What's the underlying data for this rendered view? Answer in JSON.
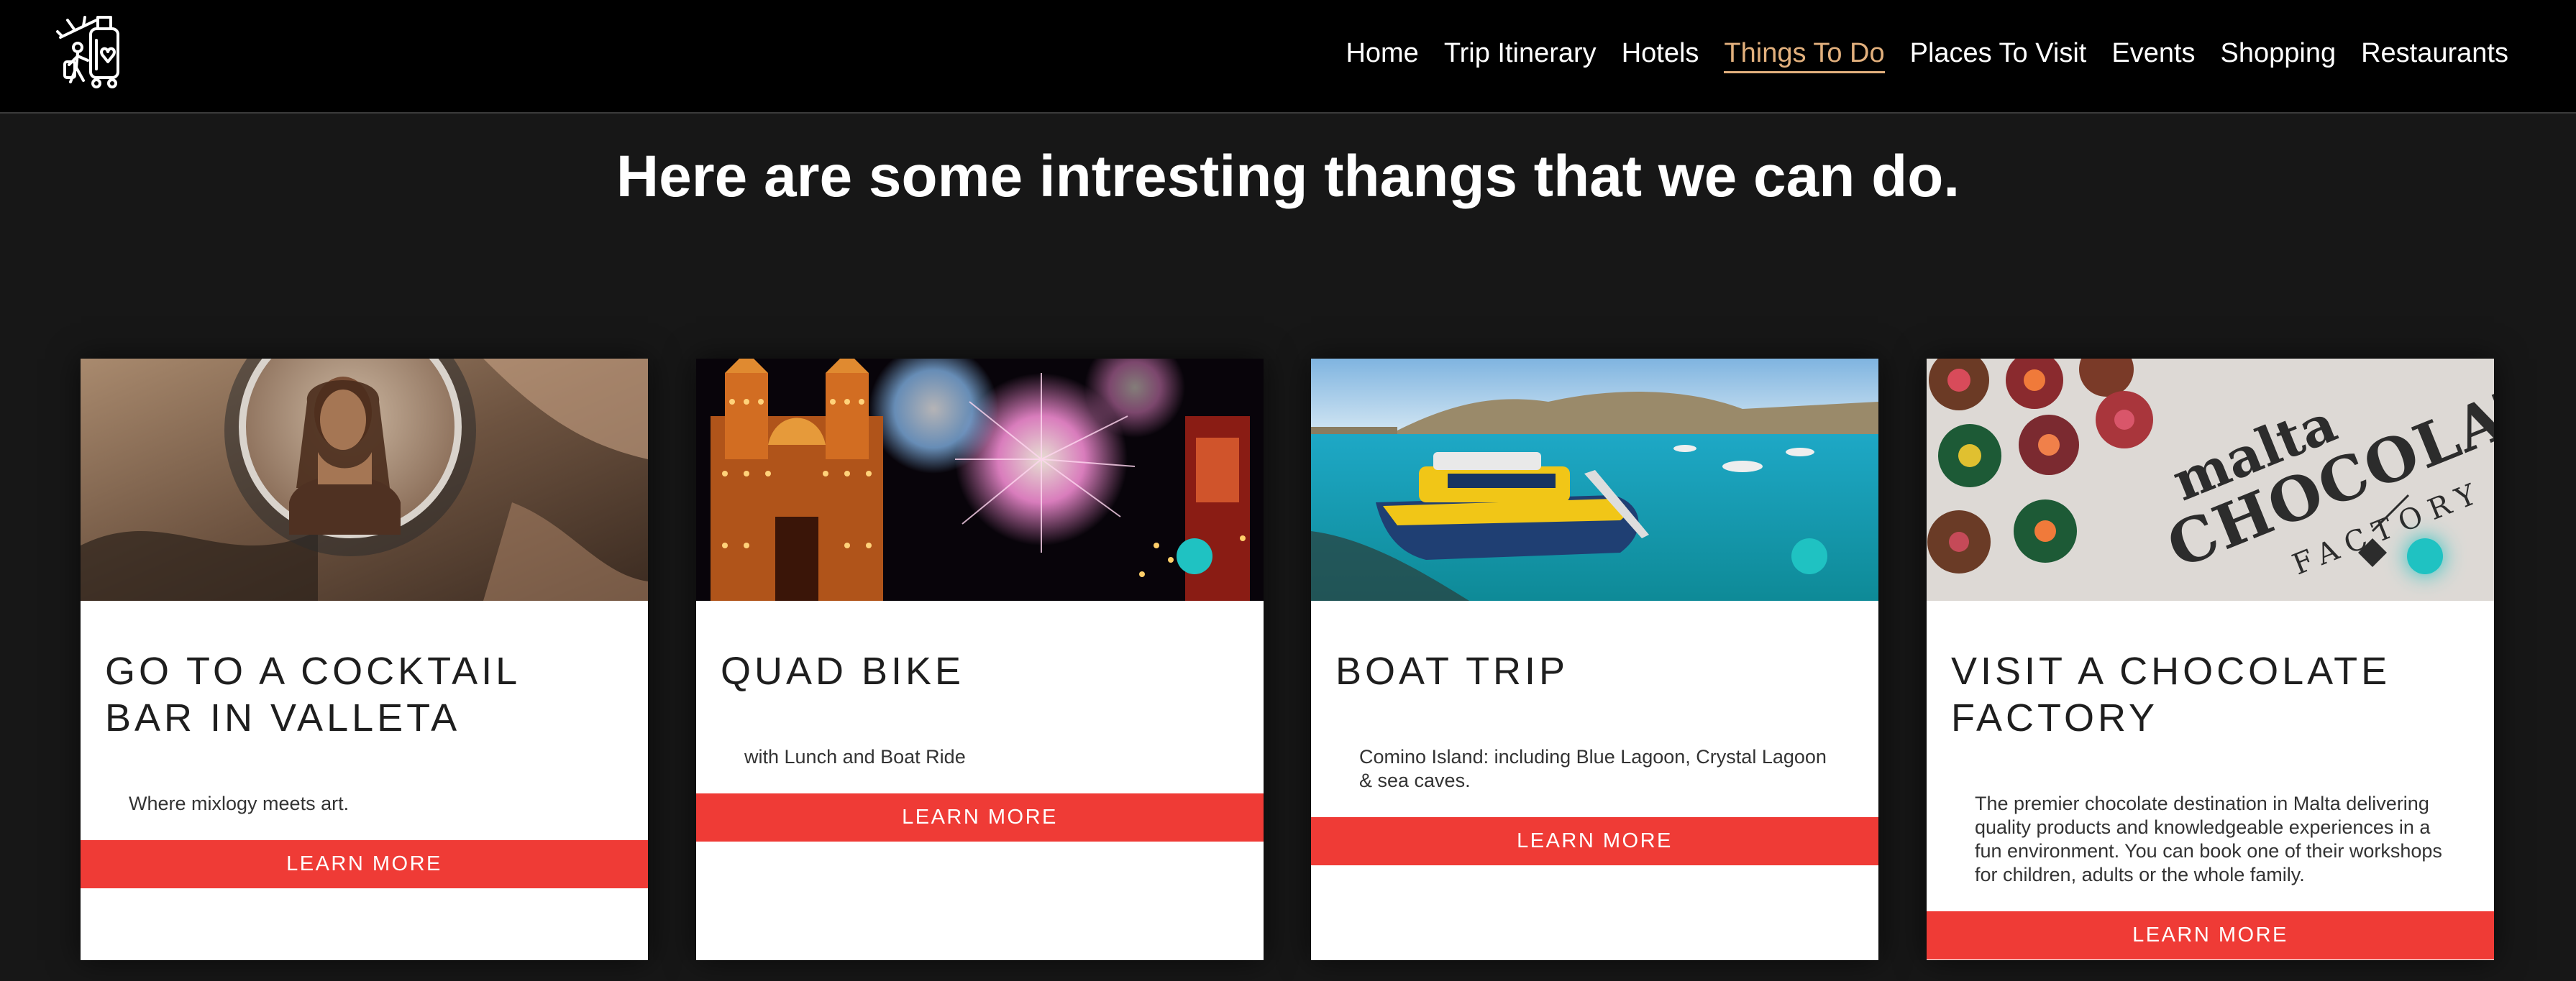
{
  "nav": {
    "items": [
      {
        "label": "Home"
      },
      {
        "label": "Trip Itinerary"
      },
      {
        "label": "Hotels"
      },
      {
        "label": "Things To Do",
        "active": true
      },
      {
        "label": "Places To Visit"
      },
      {
        "label": "Events"
      },
      {
        "label": "Shopping"
      },
      {
        "label": "Restaurants"
      }
    ],
    "active_color": "#e2b07d"
  },
  "heading": "Here are some intresting thangs that we can do.",
  "cards": [
    {
      "title": "GO TO A COCKTAIL BAR IN VALLETA",
      "description": "Where mixlogy meets art.",
      "button": "LEARN MORE",
      "image": "cocktail-art-photo"
    },
    {
      "title": "QUAD BIKE",
      "description": "with Lunch and Boat Ride",
      "button": "LEARN MORE",
      "image": "fireworks-church-photo"
    },
    {
      "title": "BOAT TRIP",
      "description": "Comino Island: including Blue Lagoon, Crystal Lagoon & sea caves.",
      "button": "LEARN MORE",
      "image": "blue-lagoon-boat-photo"
    },
    {
      "title": "VISIT A CHOCOLATE FACTORY",
      "description": "The premier chocolate destination in Malta delivering quality products and knowledgeable experiences in a fun environment. You can book one of their workshops for children, adults or the whole family.",
      "button": "LEARN MORE",
      "image": "chocolate-factory-photo",
      "image_text": [
        "malta",
        "CHOCOLATE",
        "FACTORY"
      ]
    }
  ],
  "colors": {
    "button": "#ef3b36",
    "dot": "#1fc2c2",
    "page_bg": "#171717",
    "header_bg": "#000000"
  }
}
